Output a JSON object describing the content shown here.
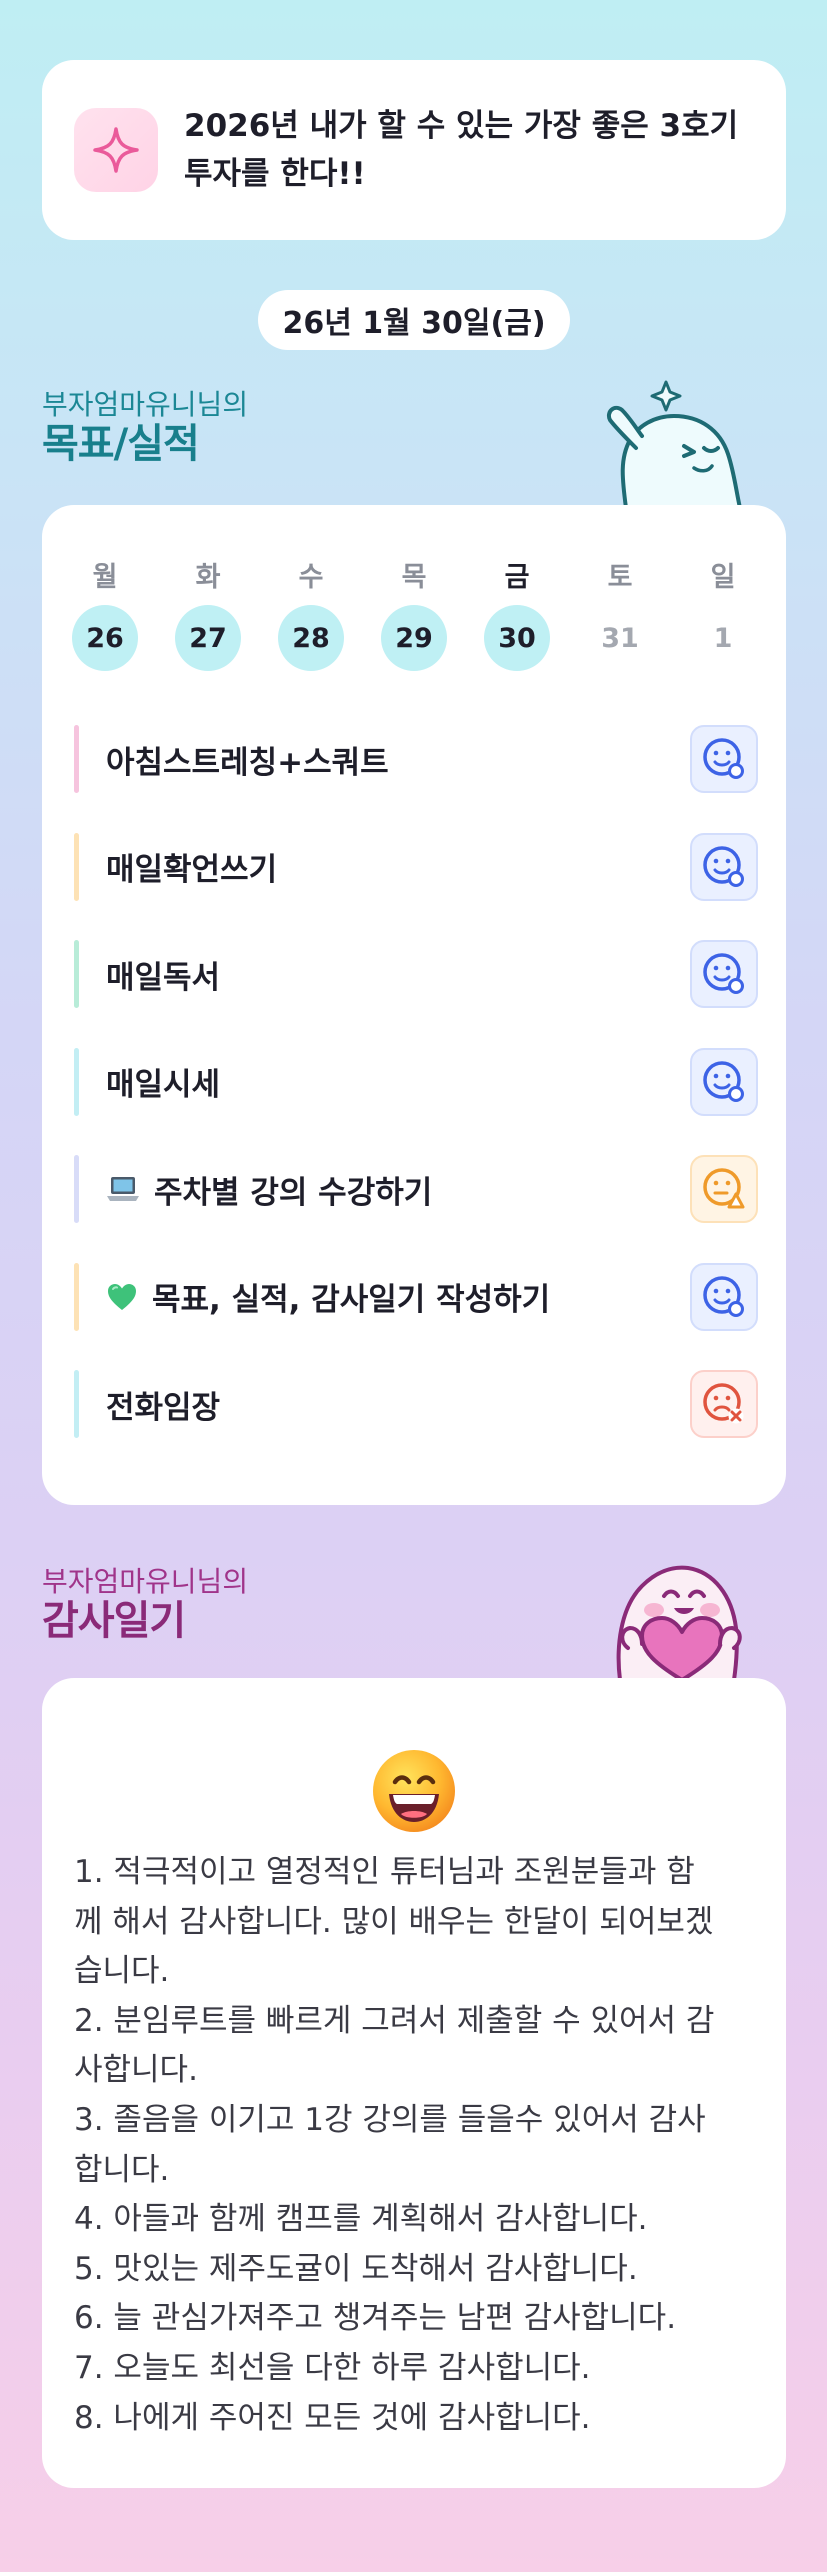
{
  "goal": {
    "icon": "sparkle-icon",
    "text": "2026년 내가 할 수 있는 가장 좋은 3호기 투자를 한다!!"
  },
  "date": "26년 1월 30일(금)",
  "goals_section": {
    "subtitle": "부자엄마유니님의",
    "title": "목표/실적"
  },
  "week": [
    {
      "name": "월",
      "num": "26",
      "state": "done"
    },
    {
      "name": "화",
      "num": "27",
      "state": "done"
    },
    {
      "name": "수",
      "num": "28",
      "state": "done"
    },
    {
      "name": "목",
      "num": "29",
      "state": "done"
    },
    {
      "name": "금",
      "num": "30",
      "state": "today"
    },
    {
      "name": "토",
      "num": "31",
      "state": "future"
    },
    {
      "name": "일",
      "num": "1",
      "state": "future"
    }
  ],
  "tasks": [
    {
      "label": "아침스트레칭+스쿼트",
      "emoji": null,
      "bar_color": "#f6c4de",
      "status": "good"
    },
    {
      "label": "매일확언쓰기",
      "emoji": null,
      "bar_color": "#fde2b5",
      "status": "good"
    },
    {
      "label": "매일독서",
      "emoji": null,
      "bar_color": "#b8ecd8",
      "status": "good"
    },
    {
      "label": "매일시세",
      "emoji": null,
      "bar_color": "#c3eef4",
      "status": "good"
    },
    {
      "label": "주차별 강의 수강하기",
      "emoji": "laptop-icon",
      "bar_color": "#d8dcf8",
      "status": "mid"
    },
    {
      "label": "목표, 실적, 감사일기 작성하기",
      "emoji": "green-heart-icon",
      "bar_color": "#fde2b5",
      "status": "good"
    },
    {
      "label": "전화임장",
      "emoji": null,
      "bar_color": "#c3eef4",
      "status": "bad"
    }
  ],
  "status_colors": {
    "good": "#3d63e6",
    "mid": "#ef9a2a",
    "bad": "#e0543f"
  },
  "gratitude_section": {
    "subtitle": "부자엄마유니님의",
    "title": "감사일기"
  },
  "gratitude": {
    "emoji": "grinning-face-icon",
    "lines": [
      "1. 적극적이고 열정적인 튜터님과 조원분들과 함",
      "께 해서 감사합니다. 많이 배우는 한달이 되어보겠",
      "습니다.",
      "2. 분임루트를 빠르게 그려서 제출할 수 있어서 감",
      "사합니다.",
      "3. 졸음을 이기고 1강 강의를 들을수 있어서 감사",
      "합니다.",
      "4. 아들과 함께 캠프를 계획해서 감사합니다.",
      "5. 맛있는 제주도귤이 도착해서 감사합니다.",
      "6. 늘 관심가져주고 챙겨주는 남편 감사합니다.",
      "7. 오늘도 최선을 다한 하루 감사합니다.",
      "8. 나에게 주어진 모든 것에 감사합니다."
    ]
  }
}
